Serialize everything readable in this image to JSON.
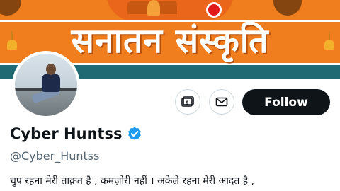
{
  "banner": {
    "title": "सनातन संस्कृति"
  },
  "profile": {
    "display_name": "Cyber Huntss",
    "verified_icon": "verified-badge-icon",
    "handle": "@Cyber_Huntss",
    "bio": "चुप रहना मेरी ताक़त है , कमज़ोरी नहीं । अकेले रहना मेरी आदत है ,"
  },
  "actions": {
    "subscribe_icon": "subscription-icon",
    "message_icon": "envelope-icon",
    "follow_label": "Follow"
  },
  "colors": {
    "banner_orange": "#f07e1e",
    "banner_teal": "#1f6a73",
    "follow_bg": "#0f1419",
    "verified_blue": "#1d9bf0",
    "handle_gray": "#536471"
  }
}
